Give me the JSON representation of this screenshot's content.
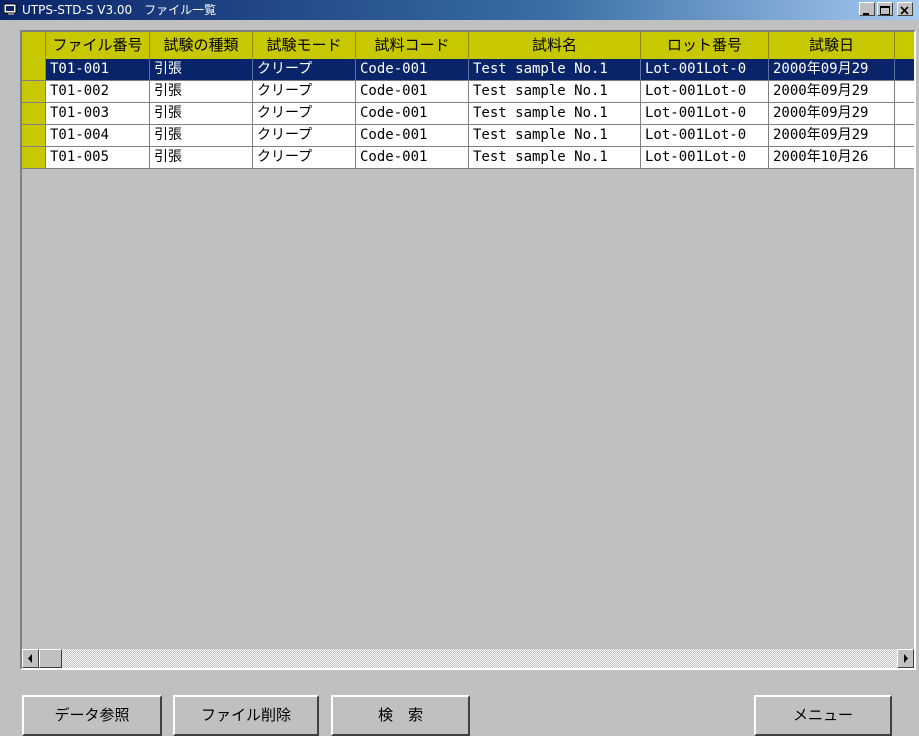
{
  "window": {
    "title": "UTPS-STD-S V3.00　ファイル一覧",
    "min_label": "_",
    "max_label": "□",
    "close_label": "×"
  },
  "table": {
    "columns": [
      "ファイル番号",
      "試験の種類",
      "試験モード",
      "試料コード",
      "試料名",
      "ロット番号",
      "試験日"
    ],
    "rows": [
      [
        "T01-001",
        "引張",
        "クリープ",
        "Code-001",
        "Test sample No.1",
        "Lot-001Lot-0",
        "2000年09月29"
      ],
      [
        "T01-002",
        "引張",
        "クリープ",
        "Code-001",
        "Test sample No.1",
        "Lot-001Lot-0",
        "2000年09月29"
      ],
      [
        "T01-003",
        "引張",
        "クリープ",
        "Code-001",
        "Test sample No.1",
        "Lot-001Lot-0",
        "2000年09月29"
      ],
      [
        "T01-004",
        "引張",
        "クリープ",
        "Code-001",
        "Test sample No.1",
        "Lot-001Lot-0",
        "2000年09月29"
      ],
      [
        "T01-005",
        "引張",
        "クリープ",
        "Code-001",
        "Test sample No.1",
        "Lot-001Lot-0",
        "2000年10月26"
      ]
    ],
    "selected_row": 0
  },
  "buttons": {
    "data_ref": "データ参照",
    "delete_file": "ファイル削除",
    "search": "検　索",
    "menu": "メニュー"
  },
  "colors": {
    "header_bg": "#c8c800",
    "selected_bg": "#0a246a",
    "titlebar": "#0a246a"
  }
}
